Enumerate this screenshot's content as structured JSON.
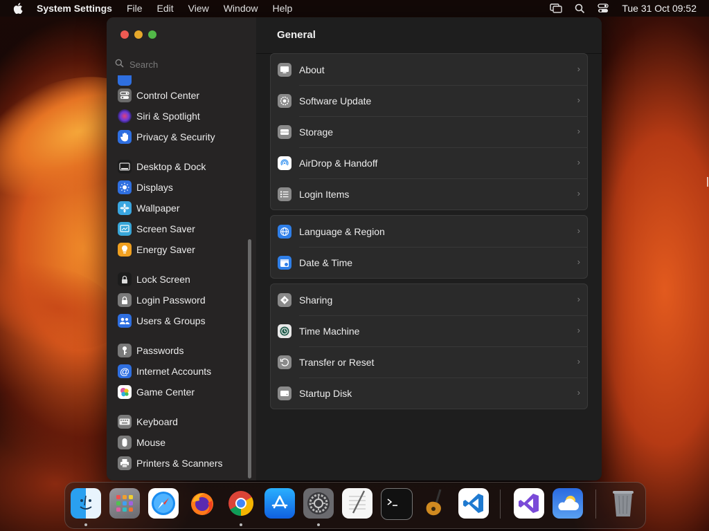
{
  "menubar": {
    "app_name": "System Settings",
    "menus": [
      "File",
      "Edit",
      "View",
      "Window",
      "Help"
    ],
    "clock": "Tue 31 Oct  09:52",
    "status_icons": [
      "screen-mirroring-icon",
      "spotlight-search-icon",
      "control-center-icon"
    ]
  },
  "window": {
    "title": "General",
    "search": {
      "placeholder": "Search",
      "value": ""
    },
    "sidebar": [
      {
        "label": "Control Center",
        "icon": "control-center-icon",
        "color": "#6b6b6b"
      },
      {
        "label": "Siri & Spotlight",
        "icon": "siri-icon",
        "color": "#2b2b5a"
      },
      {
        "label": "Privacy & Security",
        "icon": "hand-icon",
        "color": "#2f6fe0"
      },
      {
        "label": "Desktop & Dock",
        "icon": "dock-icon",
        "color": "#1c1c1c"
      },
      {
        "label": "Displays",
        "icon": "sun-icon",
        "color": "#2f6fe0"
      },
      {
        "label": "Wallpaper",
        "icon": "wallpaper-icon",
        "color": "#3aa6e0"
      },
      {
        "label": "Screen Saver",
        "icon": "screen-saver-icon",
        "color": "#38a6d8"
      },
      {
        "label": "Energy Saver",
        "icon": "lightbulb-icon",
        "color": "#f0a020"
      },
      {
        "label": "Lock Screen",
        "icon": "lock-icon",
        "color": "#1c1c1c"
      },
      {
        "label": "Login Password",
        "icon": "lock-icon",
        "color": "#7a7a7a"
      },
      {
        "label": "Users & Groups",
        "icon": "users-icon",
        "color": "#2f6fe0"
      },
      {
        "label": "Passwords",
        "icon": "key-icon",
        "color": "#7a7a7a"
      },
      {
        "label": "Internet Accounts",
        "icon": "at-icon",
        "color": "#2f6fe0"
      },
      {
        "label": "Game Center",
        "icon": "game-center-icon",
        "color": "#ffffff"
      },
      {
        "label": "Keyboard",
        "icon": "keyboard-icon",
        "color": "#7a7a7a"
      },
      {
        "label": "Mouse",
        "icon": "mouse-icon",
        "color": "#7a7a7a"
      },
      {
        "label": "Printers & Scanners",
        "icon": "printer-icon",
        "color": "#7a7a7a"
      }
    ],
    "groups": [
      [
        {
          "label": "About",
          "icon": "computer-icon",
          "color": "#8a8a8a"
        },
        {
          "label": "Software Update",
          "icon": "gear-icon",
          "color": "#8a8a8a"
        },
        {
          "label": "Storage",
          "icon": "storage-icon",
          "color": "#8a8a8a"
        },
        {
          "label": "AirDrop & Handoff",
          "icon": "airdrop-icon",
          "color": "#2f8ff0"
        },
        {
          "label": "Login Items",
          "icon": "list-icon",
          "color": "#8a8a8a"
        }
      ],
      [
        {
          "label": "Language & Region",
          "icon": "globe-icon",
          "color": "#2f7fe8"
        },
        {
          "label": "Date & Time",
          "icon": "calendar-icon",
          "color": "#2f7fe8"
        }
      ],
      [
        {
          "label": "Sharing",
          "icon": "sharing-icon",
          "color": "#8a8a8a"
        },
        {
          "label": "Time Machine",
          "icon": "time-machine-icon",
          "color": "#2a8a6a"
        },
        {
          "label": "Transfer or Reset",
          "icon": "reset-icon",
          "color": "#8a8a8a"
        },
        {
          "label": "Startup Disk",
          "icon": "disk-icon",
          "color": "#8a8a8a"
        }
      ]
    ]
  },
  "dock": [
    {
      "name": "finder-icon",
      "running": true
    },
    {
      "name": "launchpad-icon",
      "running": false
    },
    {
      "name": "safari-icon",
      "running": false
    },
    {
      "name": "firefox-icon",
      "running": false
    },
    {
      "name": "chrome-icon",
      "running": true
    },
    {
      "name": "app-store-icon",
      "running": false
    },
    {
      "name": "system-settings-icon",
      "running": true
    },
    {
      "name": "textedit-icon",
      "running": false
    },
    {
      "name": "terminal-icon",
      "running": false
    },
    {
      "name": "garageband-icon",
      "running": false
    },
    {
      "name": "vscode-icon",
      "running": false
    },
    {
      "name": "visual-studio-icon",
      "running": false
    },
    {
      "name": "weather-icon",
      "running": false
    },
    {
      "name": "trash-icon",
      "running": false
    }
  ]
}
